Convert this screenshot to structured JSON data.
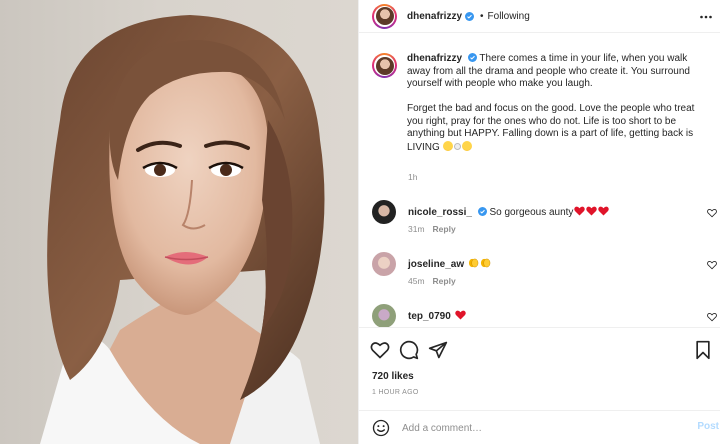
{
  "post": {
    "username": "dhenafrizzy",
    "follow_state": "Following",
    "separator": "•",
    "caption_p1": "There comes a time in your life, when you walk away from all the drama and people who create it. You surround yourself with people who make you laugh.",
    "caption_p2": "Forget the bad and focus on the good. Love the people who treat you right, pray for the ones who do not. Life is too short to be anything but HAPPY. Falling down is a part of life, getting back is LIVING",
    "caption_time": "1h"
  },
  "comments": [
    {
      "username": "nicole_rossi_",
      "text": "So gorgeous aunty",
      "emoji": "red-hearts",
      "time": "31m",
      "reply": "Reply"
    },
    {
      "username": "joseline_aw",
      "text": "",
      "emoji": "clapping-hands",
      "time": "45m",
      "reply": "Reply"
    },
    {
      "username": "tep_0790",
      "text": "",
      "emoji": "red-heart",
      "time": "",
      "reply": ""
    }
  ],
  "stats": {
    "likes": "720 likes",
    "posted": "1 HOUR AGO"
  },
  "add_comment": {
    "placeholder": "Add a comment…",
    "post_label": "Post"
  },
  "colors": {
    "verified": "#3897f0",
    "muted": "#8e8e8e",
    "post_disabled": "#b3dbff",
    "heart": "#ed4956"
  }
}
